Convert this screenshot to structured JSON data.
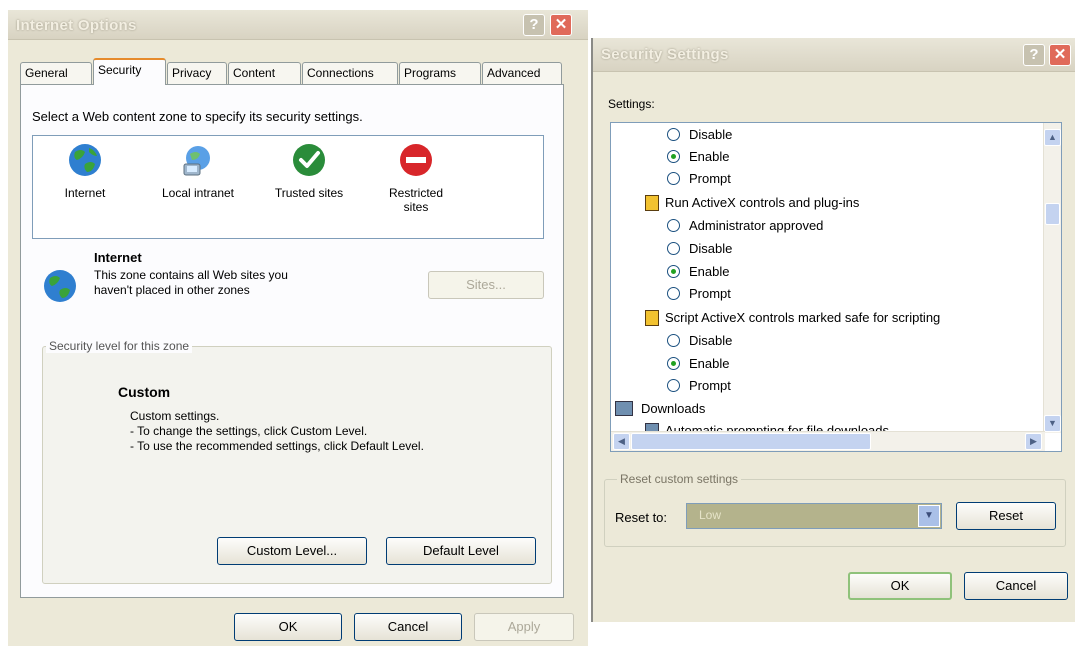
{
  "internet_options": {
    "title": "Internet Options",
    "help_btn": "?",
    "close_btn": "✕",
    "tabs": [
      "General",
      "Security",
      "Privacy",
      "Content",
      "Connections",
      "Programs",
      "Advanced"
    ],
    "instructions": "Select a Web content zone to specify its security settings.",
    "zones": [
      {
        "label": "Internet",
        "icon": "globe-icon"
      },
      {
        "label": "Local intranet",
        "icon": "intranet-icon"
      },
      {
        "label": "Trusted sites",
        "icon": "checkmark-icon"
      },
      {
        "label": "Restricted sites",
        "icon": "no-entry-icon"
      }
    ],
    "selected_zone": {
      "name": "Internet",
      "desc_line1": "This zone contains all Web sites you",
      "desc_line2": "haven't placed in other zones"
    },
    "sites_button": "Sites...",
    "security_level_legend": "Security level for this zone",
    "level_name": "Custom",
    "level_line1": "Custom settings.",
    "level_line2": "- To change the settings, click Custom Level.",
    "level_line3": "- To use the recommended settings, click Default Level.",
    "custom_level_button": "Custom Level...",
    "default_level_button": "Default Level",
    "ok": "OK",
    "cancel": "Cancel",
    "apply": "Apply"
  },
  "security_settings": {
    "title": "Security Settings",
    "help_btn": "?",
    "close_btn": "✕",
    "settings_label": "Settings:",
    "items": [
      {
        "kind": "option",
        "label": "Disable",
        "checked": false
      },
      {
        "kind": "option",
        "label": "Enable",
        "checked": true
      },
      {
        "kind": "option",
        "label": "Prompt",
        "checked": false
      },
      {
        "kind": "header",
        "label": "Run ActiveX controls and plug-ins"
      },
      {
        "kind": "option",
        "label": "Administrator approved",
        "checked": false
      },
      {
        "kind": "option",
        "label": "Disable",
        "checked": false
      },
      {
        "kind": "option",
        "label": "Enable",
        "checked": true
      },
      {
        "kind": "option",
        "label": "Prompt",
        "checked": false
      },
      {
        "kind": "header",
        "label": "Script ActiveX controls marked safe for scripting"
      },
      {
        "kind": "option",
        "label": "Disable",
        "checked": false
      },
      {
        "kind": "option",
        "label": "Enable",
        "checked": true
      },
      {
        "kind": "option",
        "label": "Prompt",
        "checked": false
      },
      {
        "kind": "category",
        "label": "Downloads"
      },
      {
        "kind": "header",
        "label": "Automatic prompting for file downloads"
      }
    ],
    "reset_legend": "Reset custom settings",
    "reset_to_label": "Reset to:",
    "reset_to_value": "Low",
    "reset_button": "Reset",
    "ok": "OK",
    "cancel": "Cancel"
  },
  "colors": {
    "dialog_bg": "#ece9d8",
    "tab_accent": "#e68b2c",
    "radio_on": "#21a121"
  }
}
